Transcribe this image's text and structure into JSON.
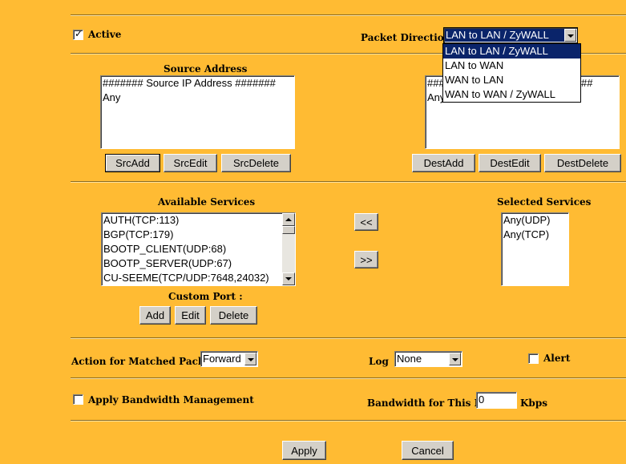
{
  "active": {
    "label": "Active",
    "checked": true
  },
  "packet_direction": {
    "label": "Packet Direction",
    "selected": "LAN to LAN / ZyWALL",
    "options": [
      "LAN to LAN / ZyWALL",
      "LAN to WAN",
      "WAN to LAN",
      "WAN to WAN / ZyWALL"
    ]
  },
  "source": {
    "title": "Source Address",
    "items": [
      "####### Source IP Address #######",
      "Any"
    ],
    "buttons": {
      "add": "SrcAdd",
      "edit": "SrcEdit",
      "delete": "SrcDelete"
    }
  },
  "destination": {
    "items_visible": [
      "###",
      "Any"
    ],
    "item_tail": "##",
    "buttons": {
      "add": "DestAdd",
      "edit": "DestEdit",
      "delete": "DestDelete"
    }
  },
  "services": {
    "available_title": "Available Services",
    "available": [
      "AUTH(TCP:113)",
      "BGP(TCP:179)",
      "BOOTP_CLIENT(UDP:68)",
      "BOOTP_SERVER(UDP:67)",
      "CU-SEEME(TCP/UDP:7648,24032)"
    ],
    "selected_title": "Selected Services",
    "selected": [
      "Any(UDP)",
      "Any(TCP)"
    ],
    "move_left": "<<",
    "move_right": ">>"
  },
  "custom_port": {
    "title": "Custom Port :",
    "buttons": {
      "add": "Add",
      "edit": "Edit",
      "delete": "Delete"
    }
  },
  "action": {
    "label": "Action for Matched Packets",
    "value": "Forward"
  },
  "log": {
    "label": "Log",
    "value": "None"
  },
  "alert": {
    "label": "Alert",
    "checked": false
  },
  "bandwidth": {
    "apply_label": "Apply Bandwidth Management",
    "apply_checked": false,
    "rule_label": "Bandwidth for This Rule",
    "rule_value": "0",
    "unit": "Kbps"
  },
  "footer": {
    "apply": "Apply",
    "cancel": "Cancel"
  },
  "colors": {
    "background": "#FFBB33",
    "highlight": "#0A246A",
    "button_face": "#D4D0C8"
  }
}
